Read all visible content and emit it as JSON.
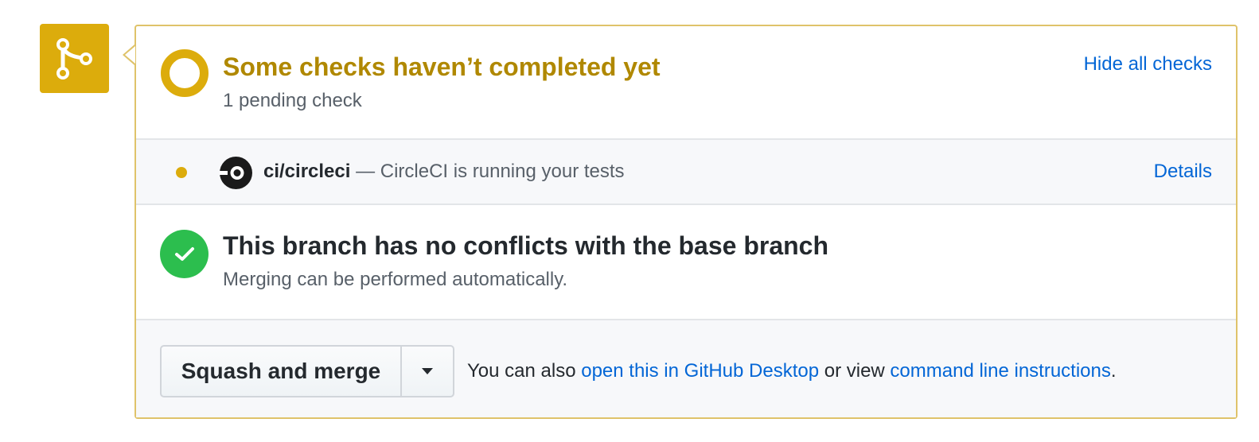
{
  "status": {
    "title": "Some checks haven’t completed yet",
    "subtitle": "1 pending check",
    "hide_link": "Hide all checks",
    "color": "#dcac0c"
  },
  "checks": [
    {
      "name": "ci/circleci",
      "description": " — CircleCI is running your tests",
      "details_label": "Details",
      "state": "pending",
      "icon": "circleci-icon"
    }
  ],
  "conflicts": {
    "title": "This branch has no conflicts with the base branch",
    "subtitle": "Merging can be performed automatically.",
    "color": "#2cbe4e"
  },
  "merge": {
    "button_label": "Squash and merge",
    "hint_prefix": "You can also ",
    "desktop_link": "open this in GitHub Desktop",
    "hint_middle": " or view ",
    "cli_link": "command line instructions",
    "hint_suffix": "."
  },
  "icons": {
    "badge": "git-merge-icon",
    "status": "pending-ring-icon",
    "ok": "check-icon",
    "dropdown": "caret-down-icon"
  },
  "colors": {
    "link": "#0366d6",
    "pending": "#dcac0c",
    "success": "#2cbe4e"
  }
}
